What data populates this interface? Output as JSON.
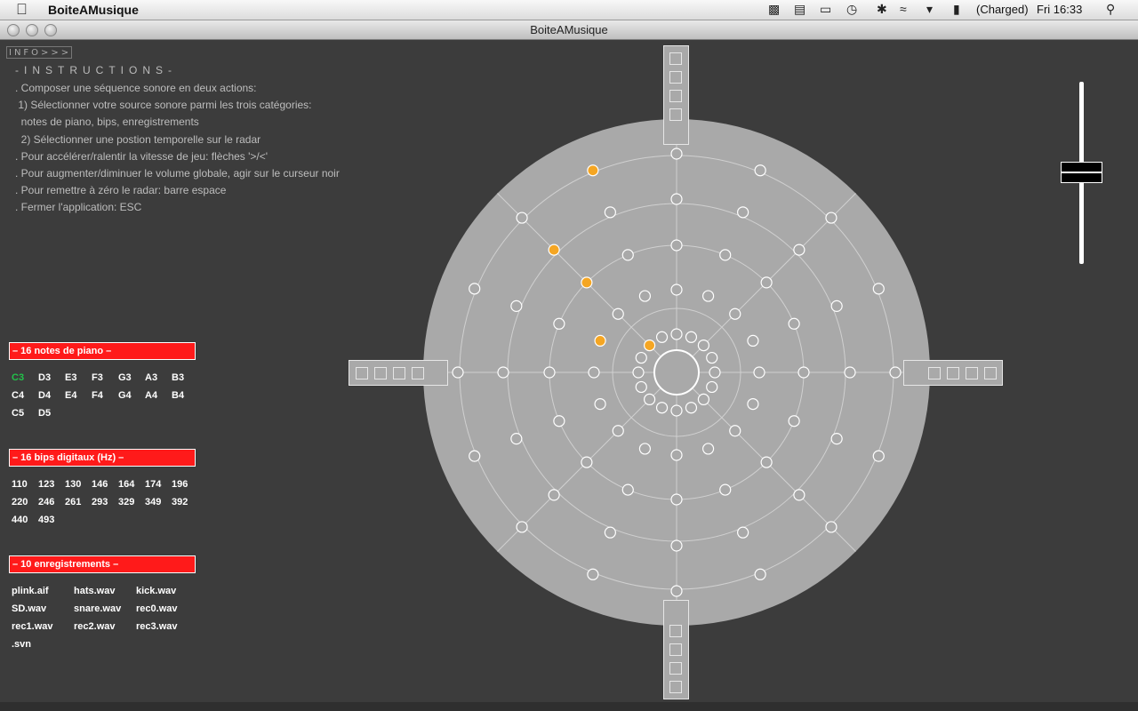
{
  "menubar": {
    "app_name": "BoiteAMusique",
    "battery": "(Charged)",
    "clock": "Fri 16:33"
  },
  "window": {
    "title": "BoiteAMusique"
  },
  "info_button": "INFO>>>",
  "instructions": {
    "title": "-INSTRUCTIONS-",
    "lines": [
      ". Composer une séquence sonore en deux actions:",
      " 1) Sélectionner votre source sonore parmi les trois catégories:",
      "  notes de piano, bips, enregistrements",
      "  2) Sélectionner une postion temporelle sur le radar",
      ". Pour accélérer/ralentir la vitesse de jeu: flèches '>/<'",
      ". Pour augmenter/diminuer le volume globale, agir sur le curseur noir",
      ". Pour remettre à zéro le radar: barre espace",
      ". Fermer l'application: ESC"
    ]
  },
  "piano": {
    "header": "– 16 notes de piano –",
    "notes": [
      "C3",
      "D3",
      "E3",
      "F3",
      "G3",
      "A3",
      "B3",
      "C4",
      "D4",
      "E4",
      "F4",
      "G4",
      "A4",
      "B4",
      "C5",
      "D5"
    ],
    "selected": "C3"
  },
  "bips": {
    "header": "– 16 bips digitaux (Hz) –",
    "values": [
      "110",
      "123",
      "130",
      "146",
      "164",
      "174",
      "196",
      "220",
      "246",
      "261",
      "293",
      "329",
      "349",
      "392",
      "440",
      "493"
    ]
  },
  "recordings": {
    "header": "– 10 enregistrements –",
    "files": [
      "plink.aif",
      "hats.wav",
      "kick.wav",
      "SD.wav",
      "snare.wav",
      "rec0.wav",
      "rec1.wav",
      "rec2.wav",
      "rec3.wav",
      ".svn"
    ]
  },
  "radar": {
    "rings": 5,
    "spokes": 8,
    "nodes_per_ring": [
      16,
      16,
      16,
      16,
      16
    ],
    "active_color": "#f5a623",
    "active_nodes": [
      {
        "ring": 4,
        "slot": 15
      },
      {
        "ring": 3,
        "slot": 14
      },
      {
        "ring": 2,
        "slot": 14
      },
      {
        "ring": 1,
        "slot": 13
      },
      {
        "ring": 0,
        "slot": 14
      }
    ]
  },
  "volume": {
    "level": 0.55
  },
  "colors": {
    "background": "#3c3c3c",
    "radar": "#a9a9a9",
    "header": "#ff1a1a",
    "selected": "#22c24a"
  }
}
